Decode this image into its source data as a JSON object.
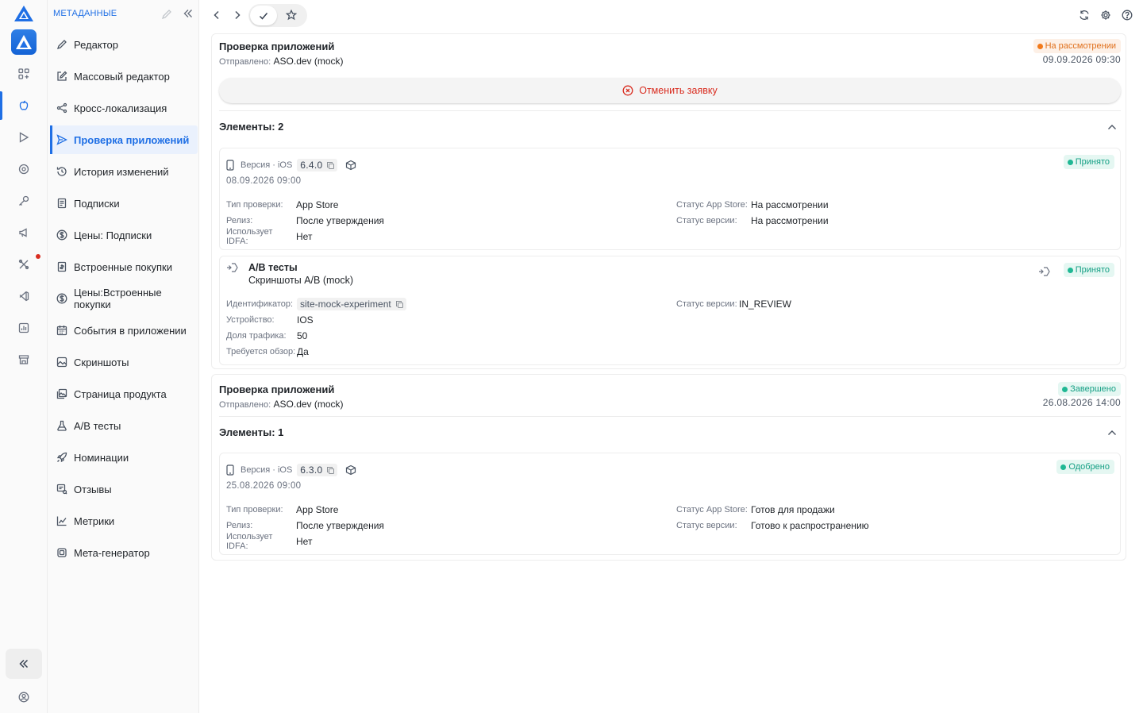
{
  "sidebar": {
    "header": "МЕТАДАННЫЕ",
    "items": [
      {
        "label": "Редактор",
        "icon": "pencil-icon"
      },
      {
        "label": "Массовый редактор",
        "icon": "edit-square-icon"
      },
      {
        "label": "Кросс-локализация",
        "icon": "share-icon"
      },
      {
        "label": "Проверка приложений",
        "icon": "send-icon",
        "active": true
      },
      {
        "label": "История изменений",
        "icon": "history-icon"
      },
      {
        "label": "Подписки",
        "icon": "receipt-icon"
      },
      {
        "label": "Цены: Подписки",
        "icon": "dollar-circle-icon"
      },
      {
        "label": "Встроенные покупки",
        "icon": "receipt-icon"
      },
      {
        "label": "Цены:Встроенные покупки",
        "icon": "dollar-circle-icon"
      },
      {
        "label": "События в приложении",
        "icon": "calendar-icon"
      },
      {
        "label": "Скриншоты",
        "icon": "image-icon"
      },
      {
        "label": "Страница продукта",
        "icon": "gallery-icon"
      },
      {
        "label": "A/B тесты",
        "icon": "flask-icon"
      },
      {
        "label": "Номинации",
        "icon": "rocket-icon"
      },
      {
        "label": "Отзывы",
        "icon": "review-icon"
      },
      {
        "label": "Метрики",
        "icon": "chart-icon"
      },
      {
        "label": "Мета-генератор",
        "icon": "chip-icon"
      }
    ]
  },
  "submissions": [
    {
      "title": "Проверка приложений",
      "sent_label": "Отправлено:",
      "sent_value": "ASO.dev (mock)",
      "status": "На рассмотрении",
      "date": "09.09.2026 09:30",
      "cancel_label": "Отменить заявку",
      "elements_title": "Элементы: 2",
      "version": {
        "label": "Версия · iOS",
        "number": "6.4.0",
        "date": "08.09.2026 09:00",
        "status": "Принято",
        "fields_left": [
          {
            "k": "Тип проверки:",
            "v": "App Store"
          },
          {
            "k": "Релиз:",
            "v": "После утверждения"
          },
          {
            "k": "Использует IDFA:",
            "v": "Нет"
          }
        ],
        "fields_right": [
          {
            "k": "Статус App Store:",
            "v": "На рассмотрении"
          },
          {
            "k": "Статус версии:",
            "v": "На рассмотрении"
          }
        ]
      },
      "ab": {
        "title": "A/B тесты",
        "subtitle": "Скриншоты A/B (mock)",
        "status": "Принято",
        "id_label": "Идентификатор:",
        "id_value": "site-mock-experiment",
        "fields_left": [
          {
            "k": "Устройство:",
            "v": "IOS"
          },
          {
            "k": "Доля трафика:",
            "v": "50"
          },
          {
            "k": "Требуется обзор:",
            "v": "Да"
          }
        ],
        "right_k": "Статус версии:",
        "right_v": "IN_REVIEW"
      }
    },
    {
      "title": "Проверка приложений",
      "sent_label": "Отправлено:",
      "sent_value": "ASO.dev (mock)",
      "status": "Завершено",
      "date": "26.08.2026 14:00",
      "elements_title": "Элементы: 1",
      "version": {
        "label": "Версия · iOS",
        "number": "6.3.0",
        "date": "25.08.2026 09:00",
        "status": "Одобрено",
        "fields_left": [
          {
            "k": "Тип проверки:",
            "v": "App Store"
          },
          {
            "k": "Релиз:",
            "v": "После утверждения"
          },
          {
            "k": "Использует IDFA:",
            "v": "Нет"
          }
        ],
        "fields_right": [
          {
            "k": "Статус App Store:",
            "v": "Готов для продажи"
          },
          {
            "k": "Статус версии:",
            "v": "Готово к распространению"
          }
        ]
      }
    }
  ],
  "colors": {
    "accent": "#1f6fe5",
    "warning": "#f27a1a",
    "success": "#20b894",
    "danger": "#d92d20"
  }
}
